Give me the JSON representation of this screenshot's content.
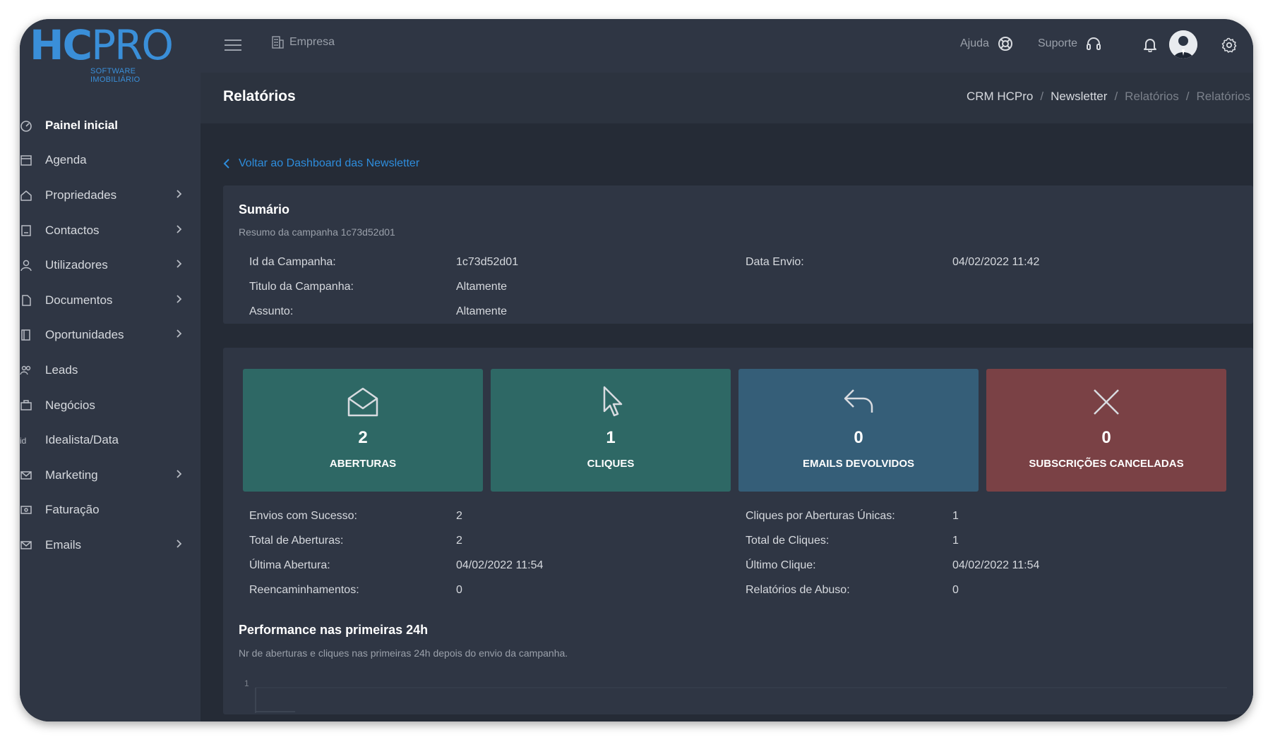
{
  "brand": {
    "logo_hc": "HC",
    "logo_pro": "PRO",
    "logo_sub": "SOFTWARE IMOBILIÁRIO",
    "accent": "#3a8fd9"
  },
  "sidebar": {
    "items": [
      {
        "label": "Painel inicial",
        "icon": "dashboard-icon",
        "has_children": false
      },
      {
        "label": "Agenda",
        "icon": "calendar-icon",
        "has_children": false
      },
      {
        "label": "Propriedades",
        "icon": "home-icon",
        "has_children": true
      },
      {
        "label": "Contactos",
        "icon": "contacts-icon",
        "has_children": true
      },
      {
        "label": "Utilizadores",
        "icon": "user-icon",
        "has_children": true
      },
      {
        "label": "Documentos",
        "icon": "document-icon",
        "has_children": true
      },
      {
        "label": "Oportunidades",
        "icon": "book-icon",
        "has_children": true
      },
      {
        "label": "Leads",
        "icon": "users-icon",
        "has_children": false
      },
      {
        "label": "Negócios",
        "icon": "briefcase-icon",
        "has_children": false
      },
      {
        "label": "Idealista/Data",
        "icon": "idealista-icon",
        "has_children": false
      },
      {
        "label": "Marketing",
        "icon": "mail-icon",
        "has_children": true
      },
      {
        "label": "Faturação",
        "icon": "invoice-icon",
        "has_children": false
      },
      {
        "label": "Emails",
        "icon": "mail-icon",
        "has_children": true
      }
    ]
  },
  "topbar": {
    "company_label": "Empresa",
    "help_label": "Ajuda",
    "support_label": "Suporte"
  },
  "header": {
    "title": "Relatórios",
    "breadcrumb": [
      "CRM HCPro",
      "Newsletter",
      "Relatórios",
      "Relatórios"
    ]
  },
  "back_link": "Voltar ao Dashboard das Newsletter",
  "summary": {
    "title": "Sumário",
    "subtitle": "Resumo da campanha 1c73d52d01",
    "left": [
      {
        "k": "Id da Campanha:",
        "v": "1c73d52d01"
      },
      {
        "k": "Titulo da Campanha:",
        "v": "Altamente"
      },
      {
        "k": "Assunto:",
        "v": "Altamente"
      }
    ],
    "right": [
      {
        "k": "Data Envio:",
        "v": "04/02/2022 11:42"
      }
    ]
  },
  "tiles": [
    {
      "value": "2",
      "label": "ABERTURAS",
      "icon": "envelope-open-icon",
      "color": "#2e6865"
    },
    {
      "value": "1",
      "label": "CLIQUES",
      "icon": "cursor-icon",
      "color": "#2e6865"
    },
    {
      "value": "0",
      "label": "EMAILS DEVOLVIDOS",
      "icon": "reply-icon",
      "color": "#355e78"
    },
    {
      "value": "0",
      "label": "SUBSCRIÇÕES CANCELADAS",
      "icon": "close-icon",
      "color": "#7a4145"
    }
  ],
  "stats": {
    "left": [
      {
        "k": "Envios com Sucesso:",
        "v": "2"
      },
      {
        "k": "Total de Aberturas:",
        "v": "2"
      },
      {
        "k": "Última Abertura:",
        "v": "04/02/2022 11:54"
      },
      {
        "k": "Reencaminhamentos:",
        "v": "0"
      }
    ],
    "right": [
      {
        "k": "Cliques por Aberturas Únicas:",
        "v": "1"
      },
      {
        "k": "Total de Cliques:",
        "v": "1"
      },
      {
        "k": "Último Clique:",
        "v": "04/02/2022 11:54"
      },
      {
        "k": "Relatórios de Abuso:",
        "v": "0"
      }
    ]
  },
  "performance": {
    "title": "Performance nas primeiras 24h",
    "subtitle": "Nr de aberturas e cliques nas primeiras 24h depois do envio da campanha.",
    "y_tick": "1"
  }
}
